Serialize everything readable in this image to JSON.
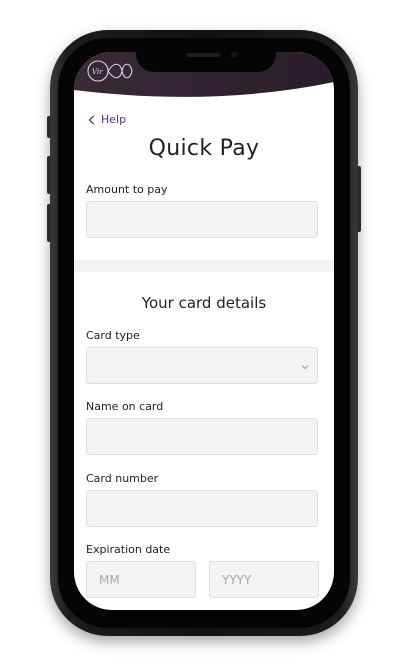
{
  "app": {
    "brand": "Virgin media"
  },
  "nav": {
    "back_label": "Help"
  },
  "page": {
    "title": "Quick Pay"
  },
  "amount": {
    "label": "Amount to pay",
    "value": "",
    "placeholder": ""
  },
  "card_section": {
    "title": "Your card details"
  },
  "card_type": {
    "label": "Card type",
    "selected": ""
  },
  "name_on_card": {
    "label": "Name on card",
    "value": "",
    "placeholder": ""
  },
  "card_number": {
    "label": "Card number",
    "value": "",
    "placeholder": ""
  },
  "expiration": {
    "label": "Expiration date",
    "month_placeholder": "MM",
    "year_placeholder": "YYYY"
  },
  "icons": {
    "back": "chevron-left-icon",
    "select": "chevron-down-icon",
    "logo": "virgin-media-logo-icon"
  },
  "colors": {
    "header": "#2e1f2c",
    "accent": "#5b2d7a",
    "field_bg": "#f3f3f3",
    "field_border": "#dedede",
    "divider": "#f4f4f4"
  }
}
